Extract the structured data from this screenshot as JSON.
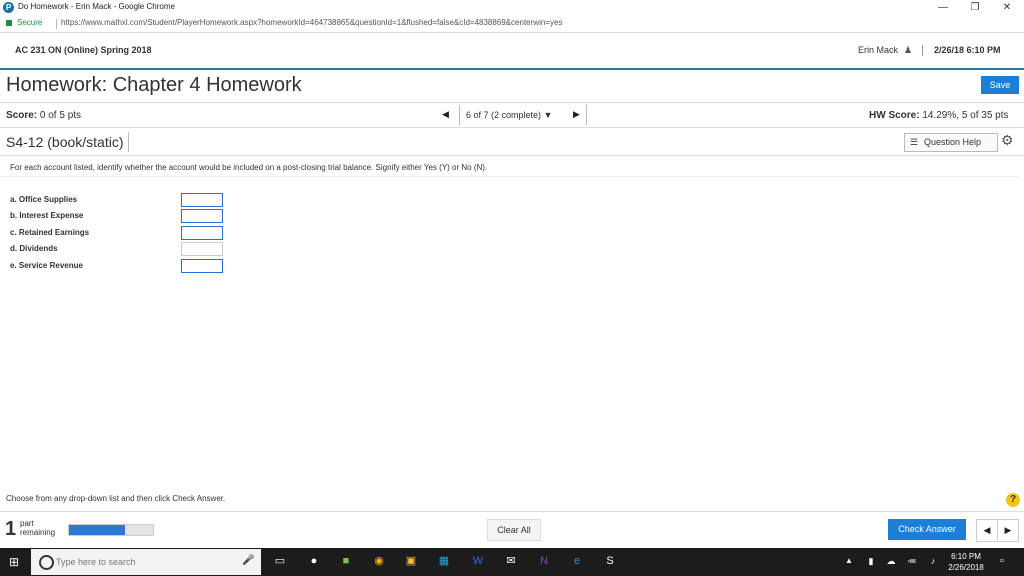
{
  "window": {
    "title": "Do Homework - Erin Mack - Google Chrome",
    "minimize": "—",
    "maximize": "❐",
    "close": "✕"
  },
  "address": {
    "secure_label": "Secure",
    "url": "https://www.mathxl.com/Student/PlayerHomework.aspx?homeworkId=464738865&questionId=1&flushed=false&cId=4838869&centerwin=yes"
  },
  "course": {
    "title": "AC 231 ON (Online) Spring 2018",
    "user": "Erin Mack",
    "datetime": "2/26/18 6:10 PM"
  },
  "homework": {
    "title": "Homework: Chapter 4 Homework",
    "save_label": "Save",
    "score_label": "Score:",
    "score_value": "0 of 5 pts",
    "question_selector": "6 of 7 (2 complete) ▼",
    "hw_score_label": "HW Score:",
    "hw_score_value": "14.29%, 5 of 35 pts",
    "question_id": "S4-12 (book/static)",
    "question_help_label": "Question Help"
  },
  "question": {
    "instructions": "For each account listed, identify whether the account would be included on a post-closing trial balance. Signify either Yes (Y) or No (N).",
    "accounts": [
      "a. Office Supplies",
      "b. Interest Expense",
      "c. Retained Earnings",
      "d. Dividends",
      "e. Service Revenue"
    ]
  },
  "footer": {
    "hint": "Choose from any drop-down list and then click Check Answer.",
    "help_glyph": "?",
    "parts_count": "1",
    "parts_label_line1": "part",
    "parts_label_line2": "remaining",
    "progress_fraction": 0.67,
    "clear_label": "Clear All",
    "check_label": "Check Answer",
    "prev_glyph": "◀",
    "next_glyph": "▶"
  },
  "taskbar": {
    "search_placeholder": "Type here to search",
    "time": "6:10 PM",
    "date": "2/26/2018"
  },
  "colors": {
    "accent": "#1c7ed6",
    "header_rule": "#2a7a9b",
    "secure": "#1e8e3e"
  }
}
